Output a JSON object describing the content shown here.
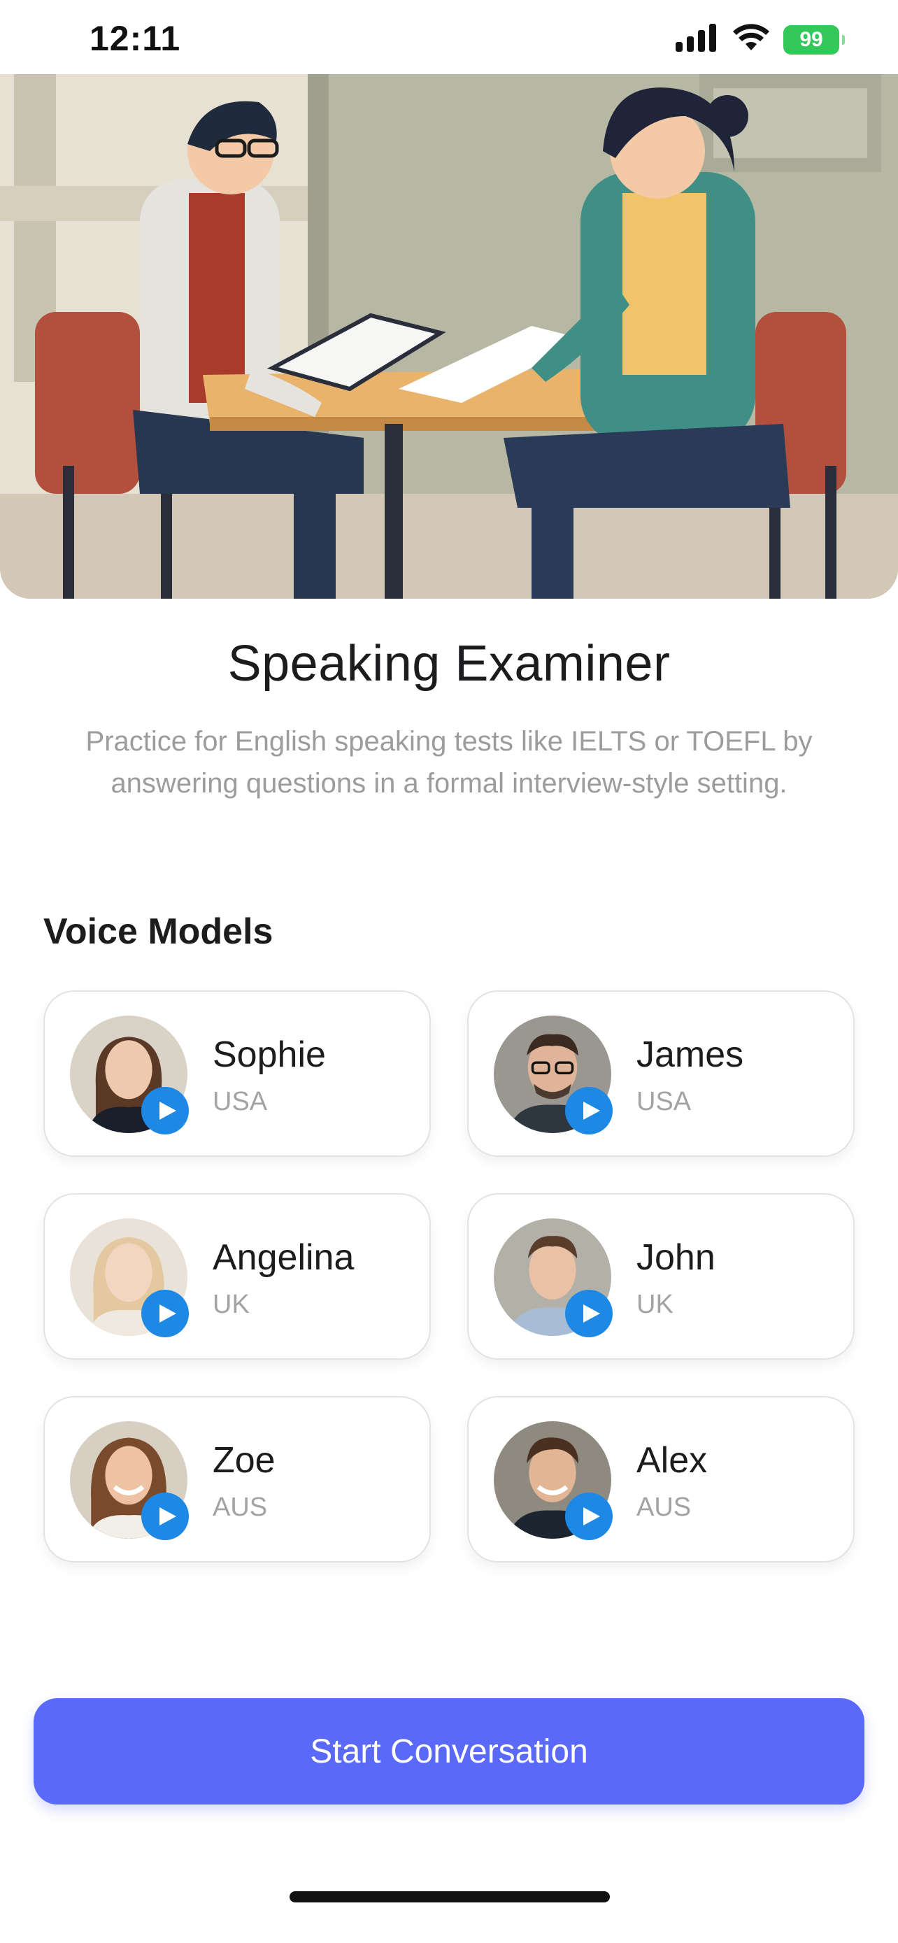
{
  "status_bar": {
    "time": "12:11",
    "battery": "99",
    "icons": [
      "signal-icon",
      "wifi-icon",
      "battery-icon"
    ]
  },
  "hero": {
    "illustration": "speaking-exam-illustration"
  },
  "header": {
    "title": "Speaking Examiner",
    "subtitle": "Practice for English speaking tests like IELTS or TOEFL by answering questions in a formal interview-style setting."
  },
  "voice_models": {
    "heading": "Voice Models",
    "items": [
      {
        "name": "Sophie",
        "region": "USA"
      },
      {
        "name": "James",
        "region": "USA"
      },
      {
        "name": "Angelina",
        "region": "UK"
      },
      {
        "name": "John",
        "region": "UK"
      },
      {
        "name": "Zoe",
        "region": "AUS"
      },
      {
        "name": "Alex",
        "region": "AUS"
      }
    ]
  },
  "cta": {
    "label": "Start Conversation"
  },
  "colors": {
    "accent": "#5a69f8",
    "play": "#1e88e5",
    "battery": "#34c759",
    "muted_text": "#9c9c9c"
  }
}
